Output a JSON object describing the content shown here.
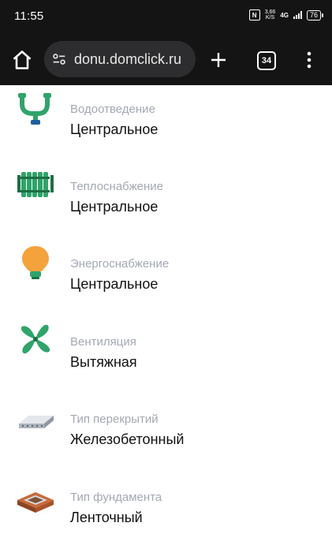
{
  "status": {
    "time": "11:55",
    "speed_value": "3,66",
    "speed_unit": "K/S",
    "network": "4G",
    "battery": "76"
  },
  "browser": {
    "url": "donu.domclick.ru",
    "tab_count": "34"
  },
  "items": [
    {
      "label": "Водоотведение",
      "value": "Центральное",
      "icon": "drain-pipe-icon"
    },
    {
      "label": "Теплоснабжение",
      "value": "Центральное",
      "icon": "radiator-icon"
    },
    {
      "label": "Энергоснабжение",
      "value": "Центральное",
      "icon": "lightbulb-icon"
    },
    {
      "label": "Вентиляция",
      "value": "Вытяжная",
      "icon": "fan-icon"
    },
    {
      "label": "Тип перекрытий",
      "value": "Железобетонный",
      "icon": "slab-icon"
    },
    {
      "label": "Тип фундамента",
      "value": "Ленточный",
      "icon": "foundation-icon"
    }
  ],
  "colors": {
    "chrome_bg": "#141414",
    "url_bar_bg": "#2d2d2f",
    "label": "#a3a8b3",
    "value": "#111111",
    "icon_green": "#2fa46a",
    "icon_orange": "#f4a23c"
  }
}
